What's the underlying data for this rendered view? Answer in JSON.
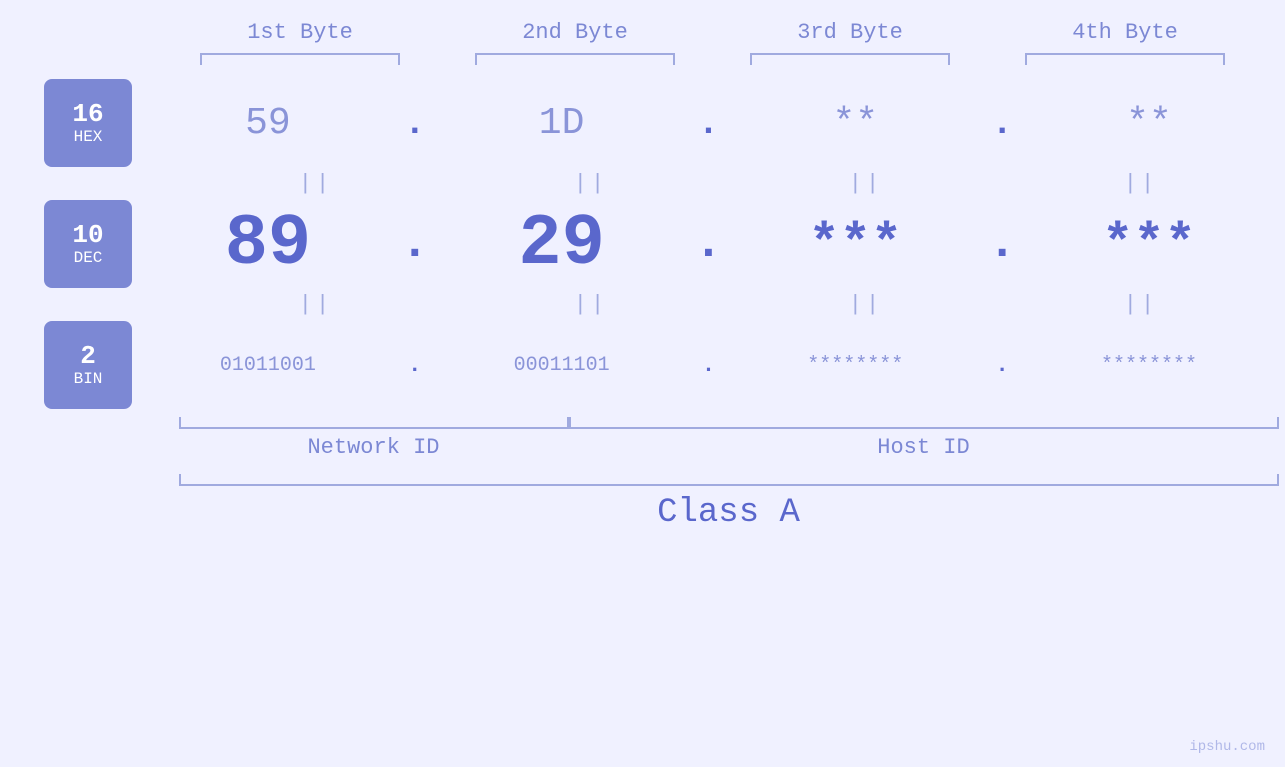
{
  "headers": {
    "byte1": "1st Byte",
    "byte2": "2nd Byte",
    "byte3": "3rd Byte",
    "byte4": "4th Byte"
  },
  "badges": {
    "hex": {
      "number": "16",
      "label": "HEX"
    },
    "dec": {
      "number": "10",
      "label": "DEC"
    },
    "bin": {
      "number": "2",
      "label": "BIN"
    }
  },
  "hex_row": {
    "b1": "59",
    "b2": "1D",
    "b3": "**",
    "b4": "**",
    "dots": [
      ".",
      ".",
      ".",
      "."
    ]
  },
  "dec_row": {
    "b1": "89",
    "b2": "29",
    "b3": "***",
    "b4": "***",
    "dots": [
      ".",
      ".",
      ".",
      "."
    ]
  },
  "bin_row": {
    "b1": "01011001",
    "b2": "00011101",
    "b3": "********",
    "b4": "********",
    "dots": [
      ".",
      ".",
      ".",
      "."
    ]
  },
  "labels": {
    "network_id": "Network ID",
    "host_id": "Host ID",
    "class": "Class A"
  },
  "equals": [
    "||",
    "||",
    "||",
    "||"
  ],
  "watermark": "ipshu.com"
}
